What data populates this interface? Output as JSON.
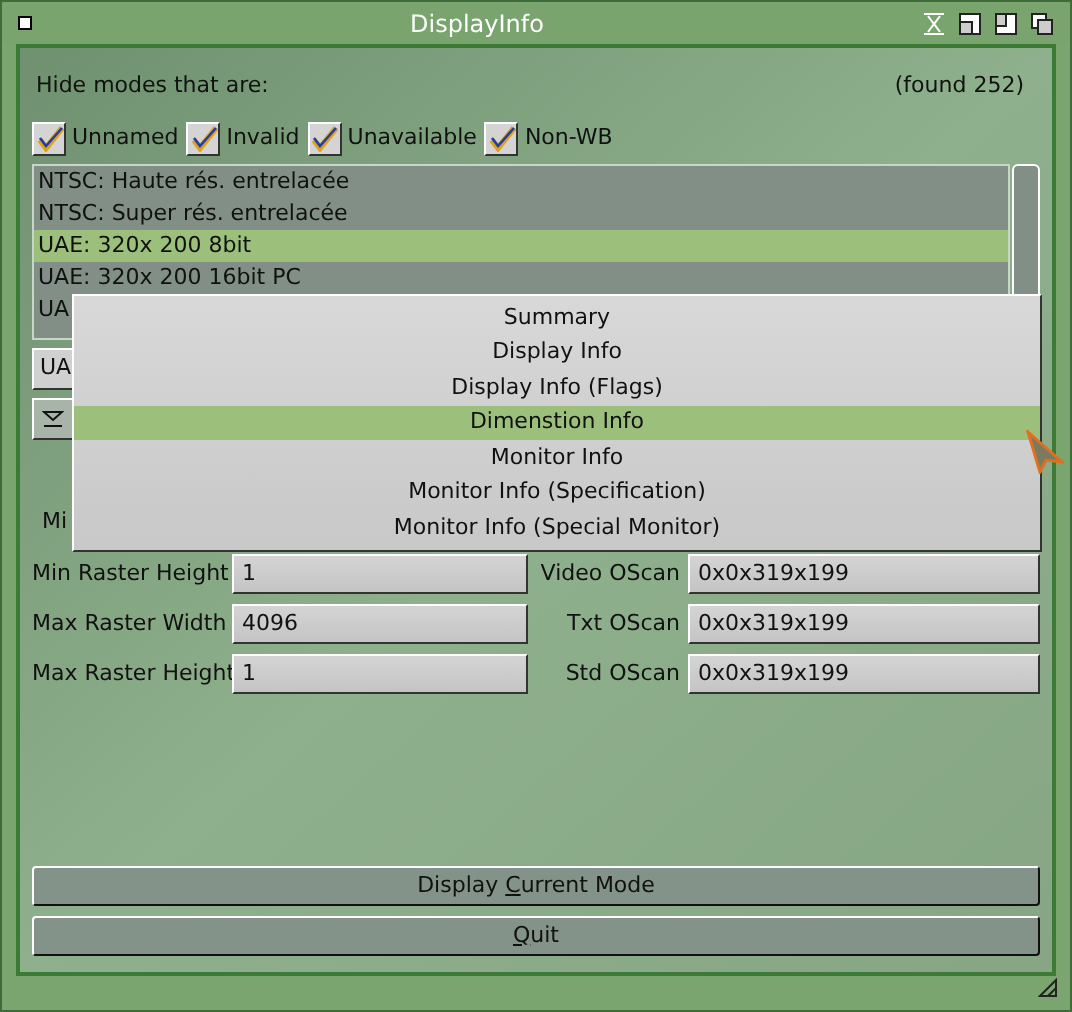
{
  "window": {
    "title": "DisplayInfo"
  },
  "filter": {
    "label": "Hide modes that are:",
    "found": "(found 252)"
  },
  "checkboxes": [
    {
      "label": "Unnamed",
      "checked": true
    },
    {
      "label": "Invalid",
      "checked": true
    },
    {
      "label": "Unavailable",
      "checked": true
    },
    {
      "label": "Non-WB",
      "checked": true
    }
  ],
  "modes": [
    {
      "label": "NTSC: Haute rés. entrelacée",
      "selected": false
    },
    {
      "label": "NTSC: Super rés. entrelacée",
      "selected": false
    },
    {
      "label": "UAE: 320x 200  8bit",
      "selected": true
    },
    {
      "label": "UAE: 320x 200 16bit PC",
      "selected": false
    },
    {
      "label": "UA",
      "selected": false
    }
  ],
  "mode_field": {
    "value": "UA"
  },
  "menu": [
    {
      "label": "Summary",
      "selected": false
    },
    {
      "label": "Display Info",
      "selected": false
    },
    {
      "label": "Display Info (Flags)",
      "selected": false
    },
    {
      "label": "Dimenstion Info",
      "selected": true
    },
    {
      "label": "Monitor Info",
      "selected": false
    },
    {
      "label": "Monitor Info (Specification)",
      "selected": false
    },
    {
      "label": "Monitor Info (Special Monitor)",
      "selected": false
    }
  ],
  "partial_label": "Mi",
  "fields": [
    {
      "label": "Min Raster Height",
      "value": "1",
      "label_2": "Video OScan",
      "value_2": "0x0x319x199"
    },
    {
      "label": "Max Raster Width",
      "value": "4096",
      "label_2": "Txt OScan",
      "value_2": "0x0x319x199"
    },
    {
      "label": "Max Raster Height",
      "value": "1",
      "label_2": "Std OScan",
      "value_2": "0x0x319x199"
    }
  ],
  "buttons": [
    {
      "before": "Display ",
      "key": "C",
      "after": "urrent Mode"
    },
    {
      "key": "Q",
      "after": "uit"
    }
  ]
}
